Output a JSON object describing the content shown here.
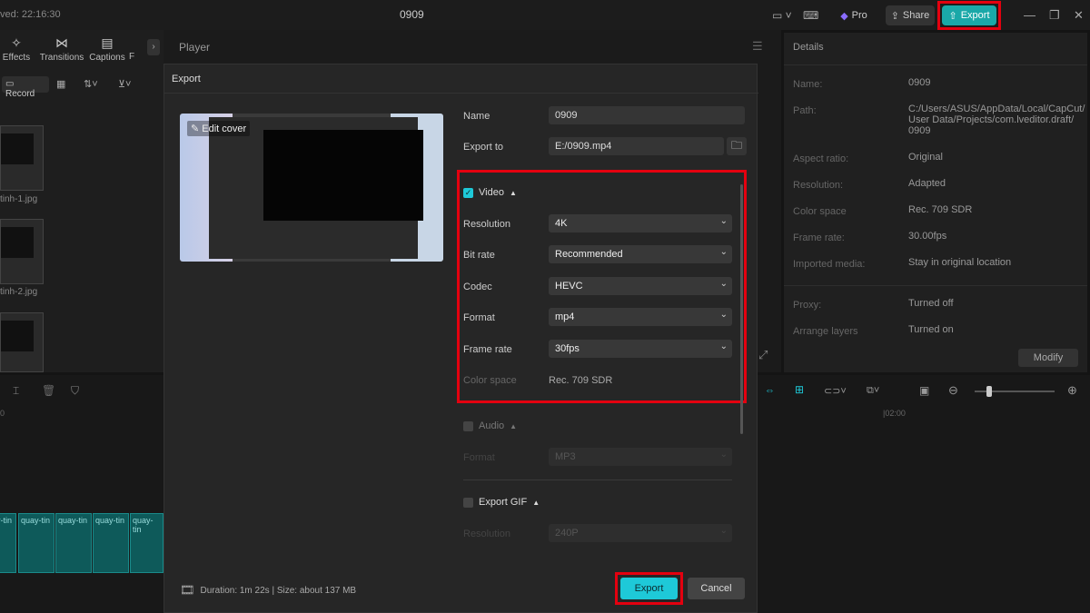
{
  "topbar": {
    "saved": "ved: 22:16:30",
    "title": "0909",
    "pro": "Pro",
    "share": "Share",
    "export": "Export"
  },
  "left_tools": [
    "Effects",
    "Transitions",
    "Captions",
    "F"
  ],
  "left_record": "Record",
  "left_files": [
    "tinh-1.jpg",
    "tinh-2.jpg"
  ],
  "player": {
    "title": "Player"
  },
  "details": {
    "title": "Details",
    "rows": [
      {
        "label": "Name:",
        "value": "0909"
      },
      {
        "label": "Path:",
        "value": "C:/Users/ASUS/AppData/Local/CapCut/ User Data/Projects/com.lveditor.draft/ 0909"
      },
      {
        "label": "Aspect ratio:",
        "value": "Original"
      },
      {
        "label": "Resolution:",
        "value": "Adapted"
      },
      {
        "label": "Color space",
        "value": "Rec. 709 SDR"
      },
      {
        "label": "Frame rate:",
        "value": "30.00fps"
      },
      {
        "label": "Imported media:",
        "value": "Stay in original location"
      },
      {
        "label": "Proxy:",
        "value": "Turned off"
      },
      {
        "label": "Arrange layers",
        "value": "Turned on"
      }
    ],
    "modify": "Modify"
  },
  "timeline": {
    "time_mark": "|02:00",
    "time_start": "0",
    "clips": [
      "quay-tin",
      "quay-tin",
      "quay-tin",
      "quay-tin",
      "quay-tin"
    ]
  },
  "dialog": {
    "title": "Export",
    "edit_cover": "Edit cover",
    "name_label": "Name",
    "name_value": "0909",
    "export_to_label": "Export to",
    "export_to_value": "E:/0909.mp4",
    "video_section": "Video",
    "video_checked": true,
    "resolution_label": "Resolution",
    "resolution_value": "4K",
    "bitrate_label": "Bit rate",
    "bitrate_value": "Recommended",
    "codec_label": "Codec",
    "codec_value": "HEVC",
    "format_label": "Format",
    "format_value": "mp4",
    "framerate_label": "Frame rate",
    "framerate_value": "30fps",
    "colorspace_label": "Color space",
    "colorspace_value": "Rec. 709 SDR",
    "audio_section": "Audio",
    "audio_format_label": "Format",
    "audio_format_value": "MP3",
    "gif_section": "Export GIF",
    "gif_resolution_label": "Resolution",
    "gif_resolution_value": "240P",
    "footer_info": "Duration: 1m 22s | Size: about 137 MB",
    "export_button": "Export",
    "cancel_button": "Cancel"
  },
  "colors": {
    "accent": "#1ec9d8",
    "highlight": "#e4000f"
  }
}
